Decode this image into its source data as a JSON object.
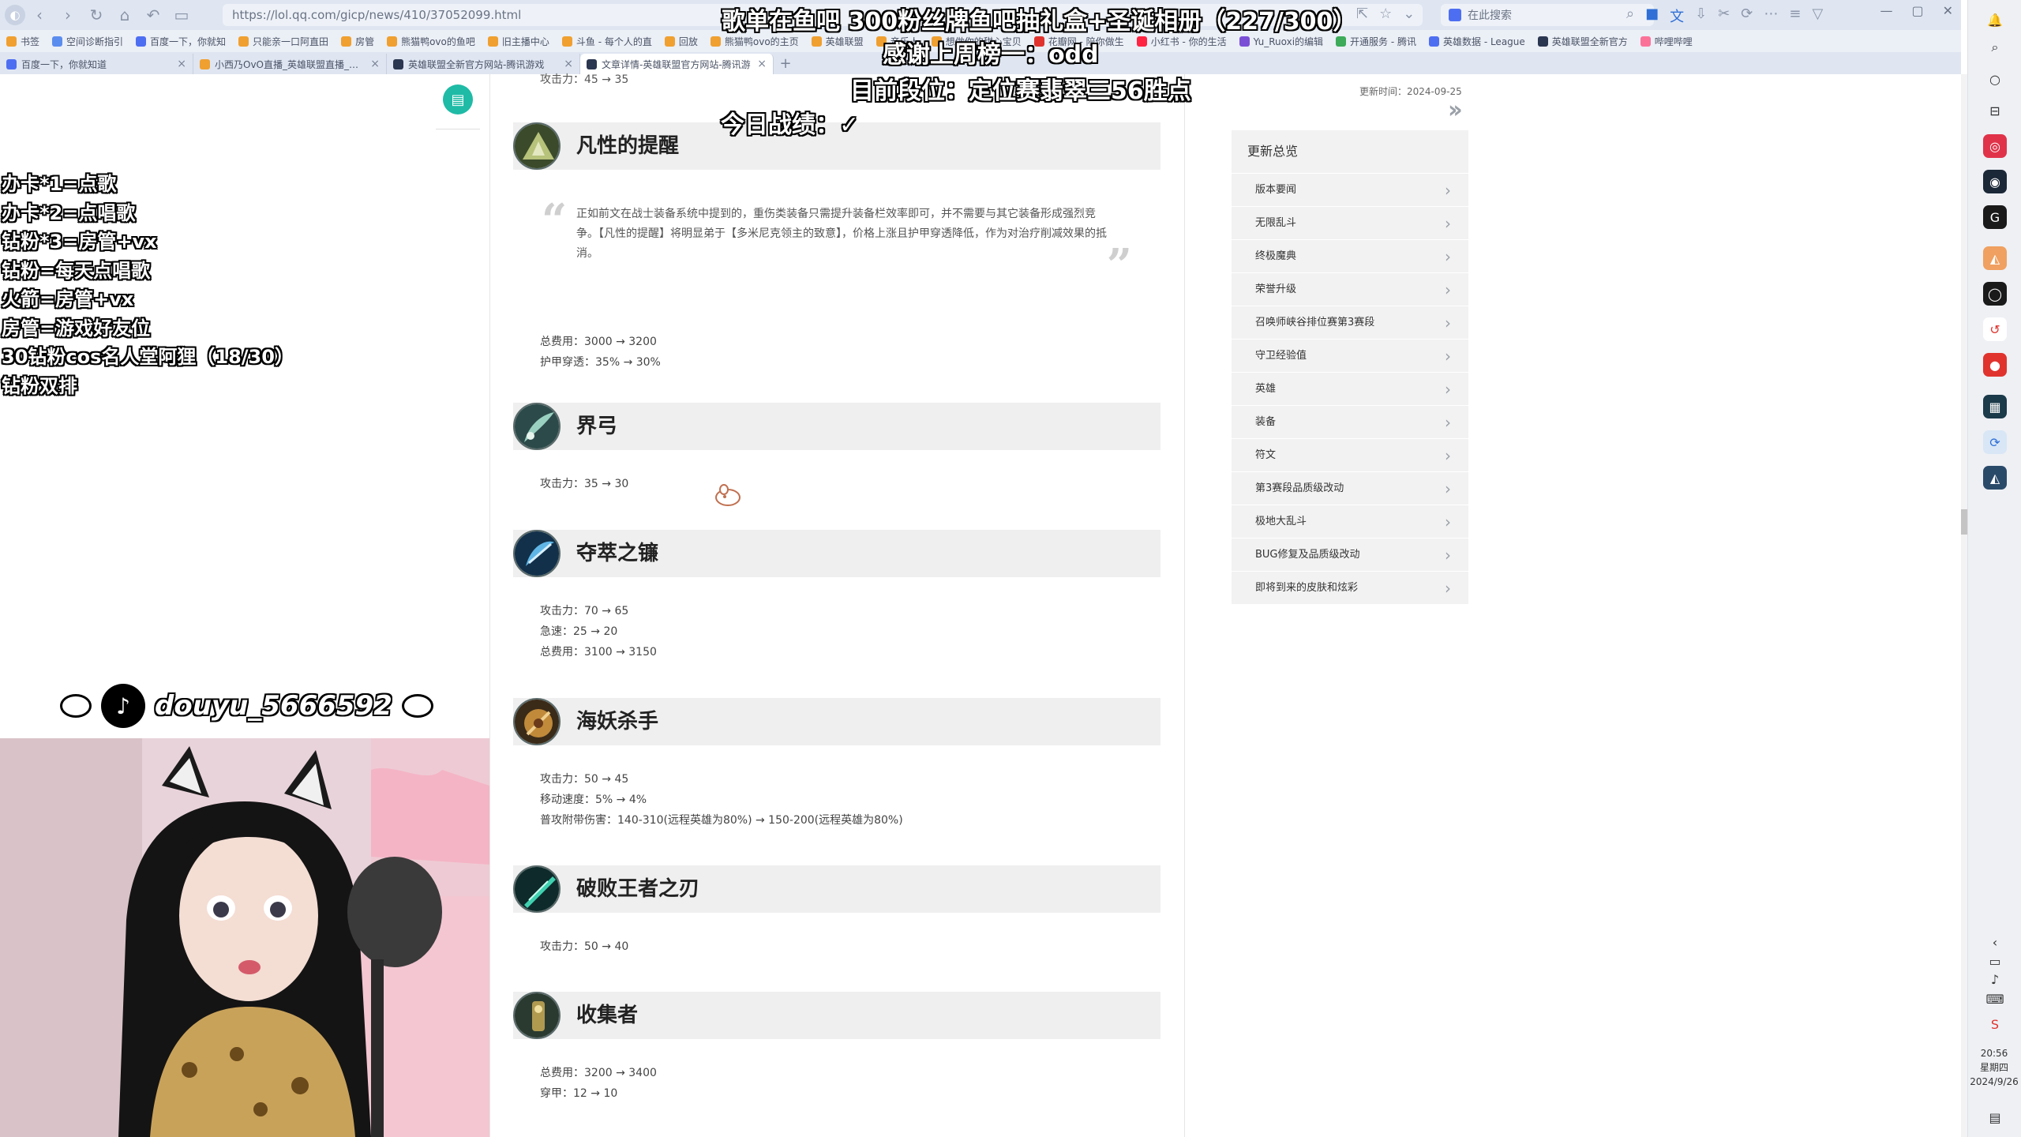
{
  "browser": {
    "url": "https://lol.qq.com/gicp/news/410/37052099.html",
    "search_placeholder": "在此搜索",
    "bookmarks": [
      "书签",
      "空间诊断指引",
      "百度一下，你就知",
      "只能亲一口阿直田",
      "房管",
      "熊猫鸭ovo的鱼吧",
      "旧主播中心",
      "斗鱼 - 每个人的直",
      "回放",
      "熊猫鸭ovo的主页",
      "英雄联盟",
      "音乐人",
      "想做你的甜心宝贝",
      "花瓣网 - 陪你做生",
      "小红书 - 你的生活",
      "Yu_Ruoxi的编辑",
      "开通服务 - 腾讯",
      "英雄数据 - League",
      "英雄联盟全新官方",
      "哔哩哔哩"
    ],
    "tabs": [
      {
        "label": "百度一下，你就知道"
      },
      {
        "label": "小西乃OvO直播_英雄联盟直播_斗鱼"
      },
      {
        "label": "英雄联盟全新官方网站-腾讯游戏"
      },
      {
        "label": "文章详情-英雄联盟官方网站-腾讯游"
      }
    ]
  },
  "overlay": {
    "top_line1": "歌单在鱼吧 300粉丝牌鱼吧抽礼盒+圣诞相册（227/300）",
    "top_line2": "感谢上周榜一：odd",
    "top_line3": "目前段位：定位赛翡翠三56胜点",
    "top_line4": "今日战绩：✓",
    "left_lines": [
      "办卡*1=点歌",
      "办卡*2=点唱歌",
      "钻粉*3=房管+vx",
      "钻粉=每天点唱歌",
      "火箭=房管+vx",
      "房管=游戏好友位",
      "30钻粉cos名人堂阿狸（18/30）",
      "钻粉双排"
    ],
    "douyin_handle": "douyu_5666592"
  },
  "article": {
    "top_stat": "攻击力：45 → 35",
    "sections": [
      {
        "title": "凡性的提醒",
        "quote": "正如前文在战士装备系统中提到的，重伤类装备只需提升装备栏效率即可，并不需要与其它装备形成强烈竞争。【凡性的提醒】将明显弟于【多米尼克领主的致意】，价格上涨且护甲穿透降低，作为对治疗削减效果的抵消。",
        "stats": [
          "总费用：3000 → 3200",
          "护甲穿透：35% → 30%"
        ]
      },
      {
        "title": "界弓",
        "stats": [
          "攻击力：35 → 30"
        ]
      },
      {
        "title": "夺萃之镰",
        "stats": [
          "攻击力：70 → 65",
          "急速：25 → 20",
          "总费用：3100 → 3150"
        ]
      },
      {
        "title": "海妖杀手",
        "stats": [
          "攻击力：50 → 45",
          "移动速度：5% → 4%",
          "普攻附带伤害：140-310(远程英雄为80%) → 150-200(远程英雄为80%)"
        ]
      },
      {
        "title": "破败王者之刃",
        "stats": [
          "攻击力：50 → 40"
        ]
      },
      {
        "title": "收集者",
        "stats": [
          "总费用：3200 → 3400",
          "穿甲：12 → 10"
        ]
      }
    ]
  },
  "sidebar": {
    "updated": "更新时间：2024-09-25",
    "title": "更新总览",
    "items": [
      "版本要闻",
      "无限乱斗",
      "终极魔典",
      "荣誉升级",
      "召唤师峡谷排位赛第3赛段",
      "守卫经验值",
      "英雄",
      "装备",
      "符文",
      "第3赛段品质级改动",
      "极地大乱斗",
      "BUG修复及品质级改动",
      "即将到来的皮肤和炫彩"
    ]
  },
  "system": {
    "time": "20:56",
    "weekday": "星期四",
    "date": "2024/9/26"
  },
  "colors": {
    "accent_teal": "#1fbba6",
    "section_bar": "#efefef",
    "sidebar_bg": "#f2f2f2"
  }
}
